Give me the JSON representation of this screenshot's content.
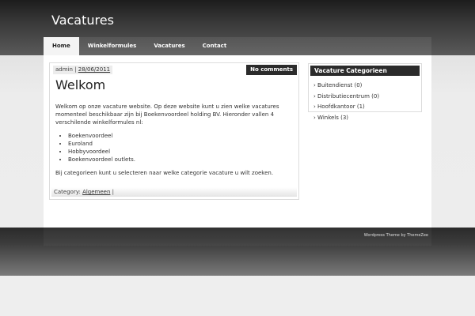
{
  "site": {
    "title": "Vacatures"
  },
  "nav": {
    "items": [
      "Home",
      "Winkelformules",
      "Vacatures",
      "Contact"
    ],
    "active": "Home"
  },
  "post": {
    "author": "admin",
    "separator": " | ",
    "date": "28/06/2011",
    "comments": "No comments",
    "title": "Welkom",
    "intro": "Welkom op onze vacature website. Op deze website kunt u zien welke vacatures momenteel beschikbaar zijn bij Boekenvoordeel holding BV. Hieronder vallen 4 verschilende winkelformules nl:",
    "list": [
      "Boekenvoordeel",
      "Euroland",
      "Hobbyvoordeel",
      "Boekenvoordeel outlets."
    ],
    "outro": "Bij categorieen kunt u selecteren naar welke categorie vacature u wilt zoeken.",
    "category_label": "Category:",
    "category": "Algemeen",
    "category_suffix": " |"
  },
  "sidebar": {
    "title": "Vacature Categorieen",
    "items": [
      "Buitendienst (0)",
      "Distributiecentrum (0)",
      "Hoofdkantoor (1)",
      "Winkels (3)"
    ]
  },
  "footer": {
    "credit": "Wordpress Theme by ThemeZee"
  },
  "colors": {
    "dark": "#2b2b2b",
    "page": "#ffffff",
    "accent_nav_active": "#f4f4f4"
  },
  "icons": {
    "list_marker": "chevron-right-icon"
  }
}
